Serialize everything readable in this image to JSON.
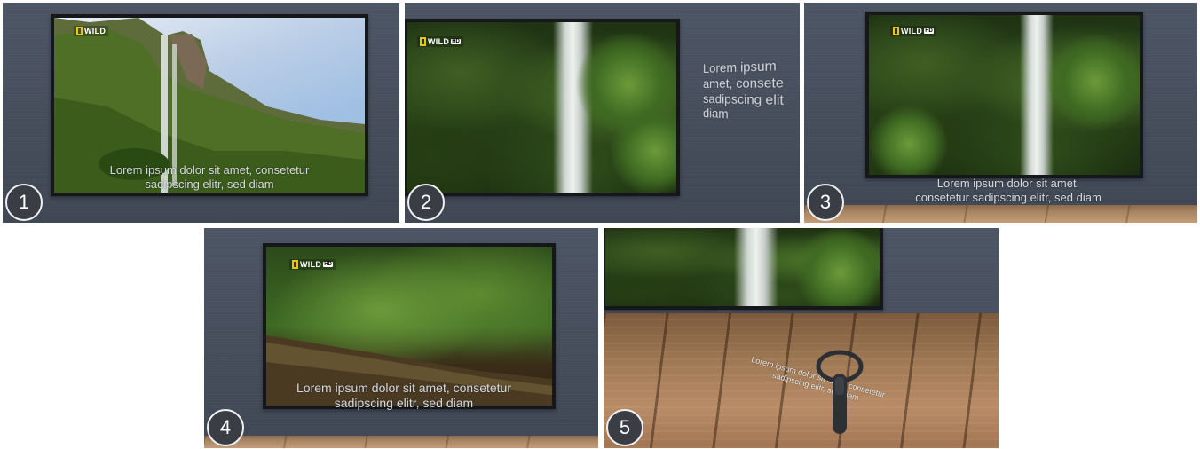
{
  "logo": {
    "text": "WILD",
    "hd": "HD"
  },
  "steps": [
    "1",
    "2",
    "3",
    "4",
    "5"
  ],
  "captions": {
    "p1": [
      "Lorem ipsum dolor sit amet, consetetur",
      "sadipscing elitr, sed diam"
    ],
    "p2": [
      "Lorem ipsum",
      "amet, consete",
      "sadipscing elit",
      "diam"
    ],
    "p3": [
      "Lorem ipsum dolor sit amet,",
      "consetetur sadipscing elitr, sed diam"
    ],
    "p4": [
      "Lorem ipsum dolor sit amet, consetetur",
      "sadipscing elitr, sed diam"
    ],
    "p5": [
      "Lorem ipsum dolor sit amet, consetetur",
      "sadipscing elitr, sed diam"
    ]
  },
  "colors": {
    "wall": "#454d5b",
    "frame": "#15171b",
    "badge": "#3a3e44",
    "caption": "#d4d8de",
    "logo_accent": "#f1c400"
  }
}
